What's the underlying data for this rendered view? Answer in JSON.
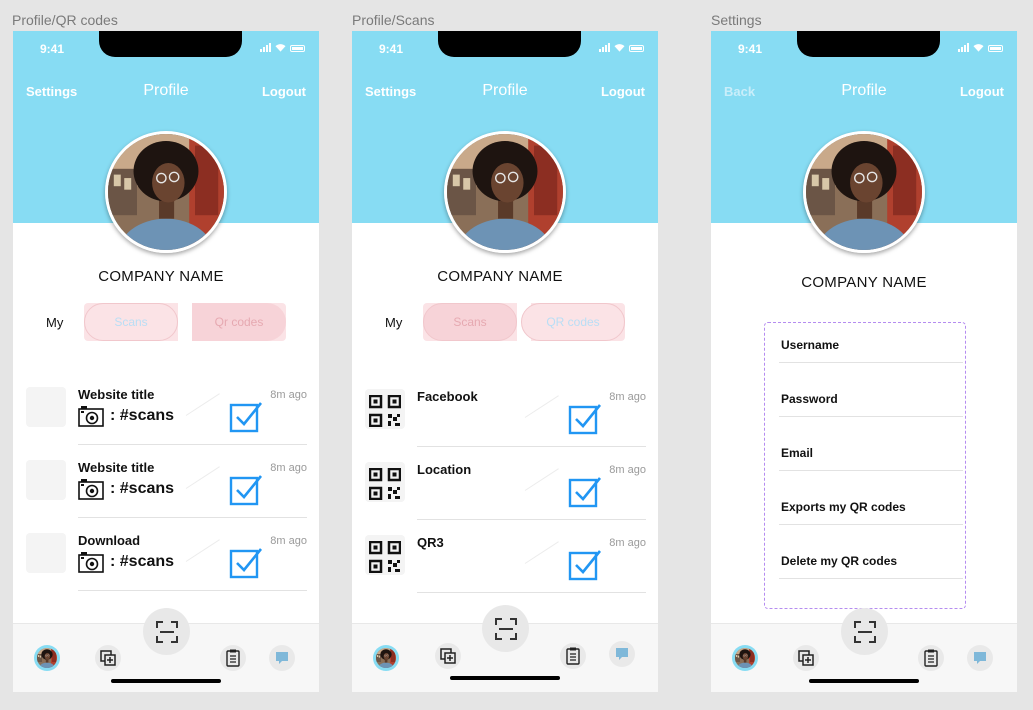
{
  "frames": [
    {
      "label": "Profile/QR codes",
      "status_time": "9:41",
      "nav_left": "Settings",
      "nav_title": "Profile",
      "nav_right": "Logout",
      "company": "COMPANY NAME",
      "my_label": "My",
      "seg_left": "Scans",
      "seg_right": "Qr codes",
      "rows": [
        {
          "title": "Website title",
          "ago": "8m ago",
          "scans": ": #scans"
        },
        {
          "title": "Website title",
          "ago": "8m ago",
          "scans": ": #scans"
        },
        {
          "title": "Download",
          "ago": "8m ago",
          "scans": ": #scans"
        }
      ]
    },
    {
      "label": "Profile/Scans",
      "status_time": "9:41",
      "nav_left": "Settings",
      "nav_title": "Profile",
      "nav_right": "Logout",
      "company": "COMPANY NAME",
      "my_label": "My",
      "seg_left": "Scans",
      "seg_right": "QR codes",
      "rows": [
        {
          "title": "Facebook",
          "ago": "8m ago"
        },
        {
          "title": "Location",
          "ago": "8m ago"
        },
        {
          "title": "QR3",
          "ago": "8m ago"
        }
      ]
    },
    {
      "label": "Settings",
      "status_time": "9:41",
      "nav_left": "Back",
      "nav_title": "Profile",
      "nav_right": "Logout",
      "company": "COMPANY NAME",
      "settings": [
        "Username",
        "Password",
        "Email",
        "Exports my QR codes",
        "Delete my QR codes"
      ]
    }
  ],
  "colors": {
    "header": "#87dcf3",
    "check": "#2196f3",
    "settings_border": "#b58cf0",
    "segment": "#fbe3e6"
  },
  "icons": {
    "scan_button": "scan-frame-icon",
    "add_tab": "add-square-icon",
    "list_tab": "clipboard-list-icon",
    "flag_tab": "flag-icon",
    "camera": "camera-icon",
    "check": "checkbox-checked-icon",
    "qr": "qr-code-icon"
  }
}
